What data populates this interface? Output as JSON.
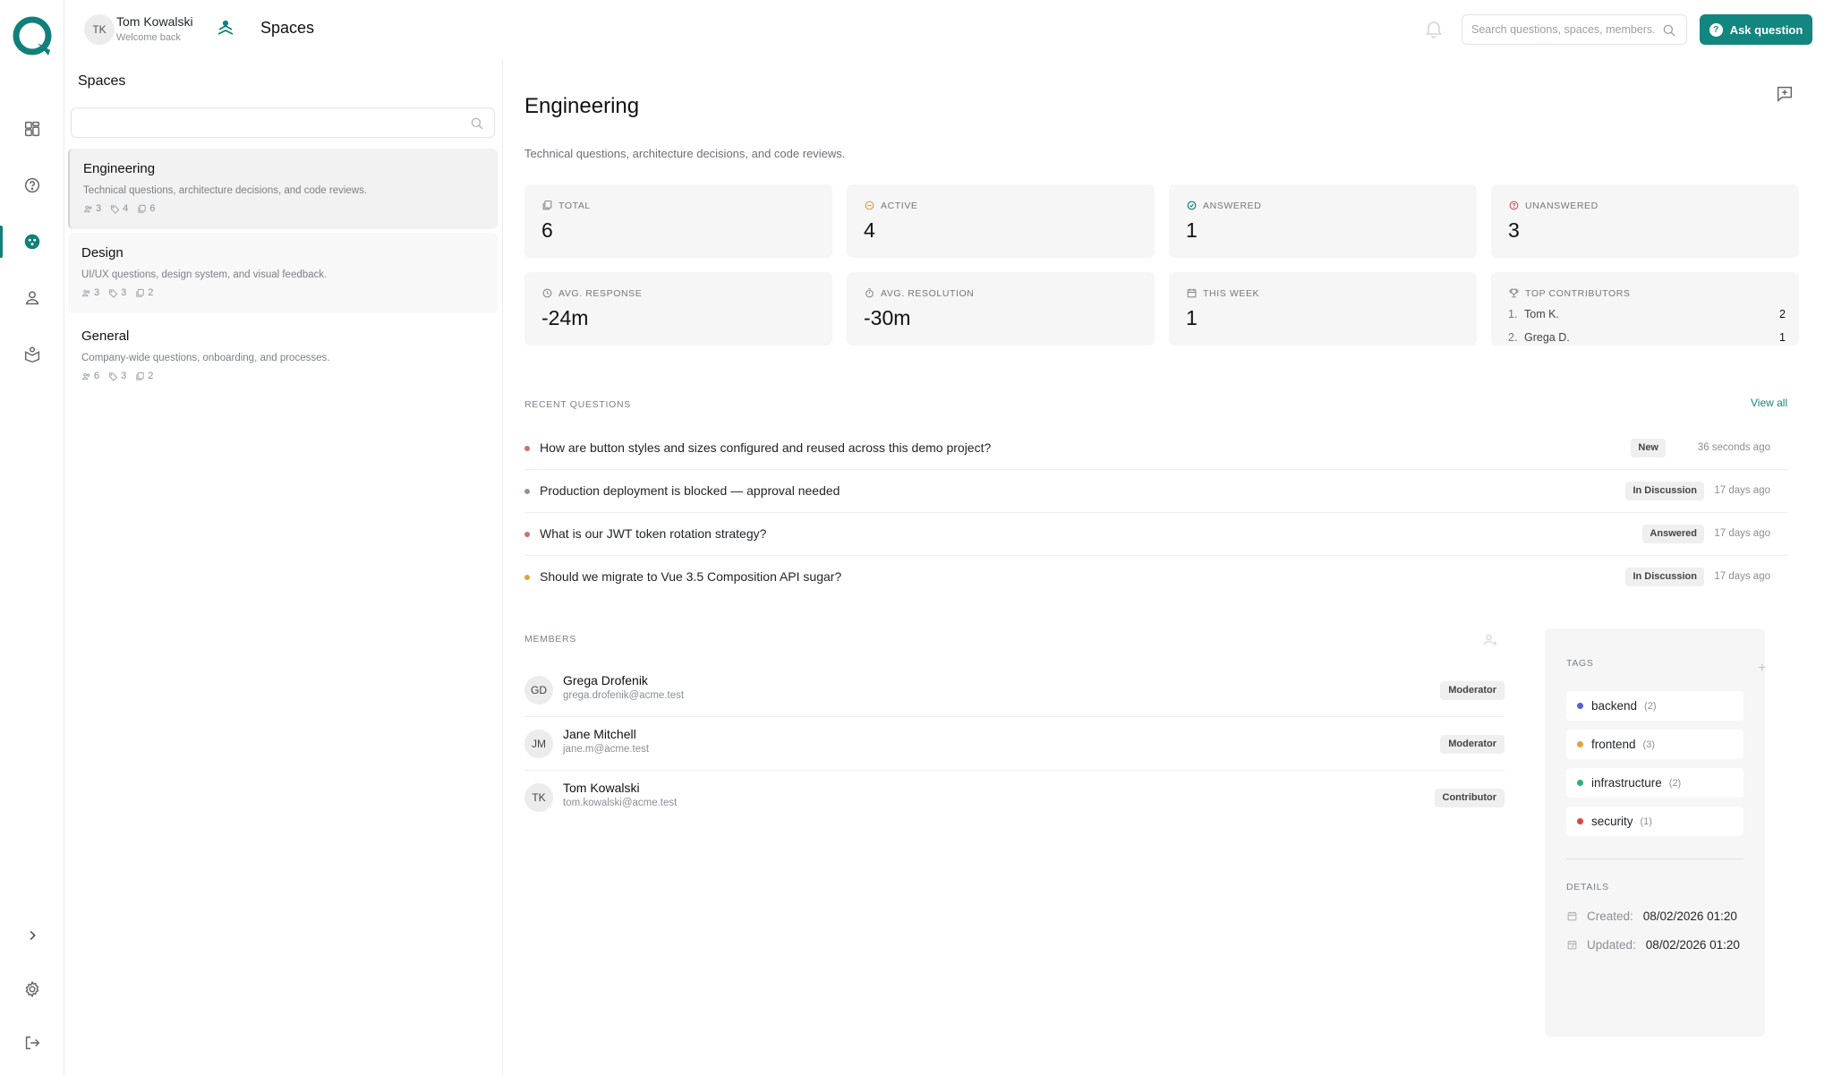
{
  "header": {
    "avatar_initials": "TK",
    "user_name": "Tom Kowalski",
    "user_subtitle": "Welcome back",
    "page_title": "Spaces",
    "search_placeholder": "Search questions, spaces, members...",
    "ask_button": "Ask question",
    "brand_color": "#12867f"
  },
  "spaces_panel": {
    "title": "Spaces",
    "search_placeholder": "",
    "items": [
      {
        "name": "Engineering",
        "description": "Technical questions, architecture decisions, and code reviews.",
        "members": "3",
        "tags": "4",
        "questions": "6"
      },
      {
        "name": "Design",
        "description": "UI/UX questions, design system, and visual feedback.",
        "members": "3",
        "tags": "3",
        "questions": "2"
      },
      {
        "name": "General",
        "description": "Company-wide questions, onboarding, and processes.",
        "members": "6",
        "tags": "3",
        "questions": "2"
      }
    ]
  },
  "space": {
    "title": "Engineering",
    "description": "Technical questions, architecture decisions, and code reviews."
  },
  "stats": {
    "total": {
      "label": "TOTAL",
      "value": "6"
    },
    "active": {
      "label": "ACTIVE",
      "value": "4"
    },
    "answered": {
      "label": "ANSWERED",
      "value": "1"
    },
    "unanswered": {
      "label": "UNANSWERED",
      "value": "3"
    },
    "avg_response": {
      "label": "AVG. RESPONSE",
      "value": "-24m"
    },
    "avg_resolution": {
      "label": "AVG. RESOLUTION",
      "value": "-30m"
    },
    "this_week": {
      "label": "THIS WEEK",
      "value": "1"
    },
    "top_contributors": {
      "label": "TOP CONTRIBUTORS",
      "items": [
        {
          "rank": "1.",
          "name": "Tom K.",
          "count": "2"
        },
        {
          "rank": "2.",
          "name": "Grega D.",
          "count": "1"
        }
      ]
    }
  },
  "recent_questions": {
    "label": "RECENT QUESTIONS",
    "view_all": "View all",
    "items": [
      {
        "title": "How are button styles and sizes configured and reused across this demo project?",
        "status": "New",
        "time": "36 seconds ago",
        "dot_color": "#d0706b"
      },
      {
        "title": "Production deployment is blocked — approval needed",
        "status": "In Discussion",
        "time": "17 days ago",
        "dot_color": "#8a949e"
      },
      {
        "title": "What is our JWT token rotation strategy?",
        "status": "Answered",
        "time": "17 days ago",
        "dot_color": "#d0706b"
      },
      {
        "title": "Should we migrate to Vue 3.5 Composition API sugar?",
        "status": "In Discussion",
        "time": "17 days ago",
        "dot_color": "#d9a640"
      }
    ]
  },
  "members": {
    "label": "MEMBERS",
    "items": [
      {
        "initials": "GD",
        "name": "Grega Drofenik",
        "email": "grega.drofenik@acme.test",
        "role": "Moderator"
      },
      {
        "initials": "JM",
        "name": "Jane Mitchell",
        "email": "jane.m@acme.test",
        "role": "Moderator"
      },
      {
        "initials": "TK",
        "name": "Tom Kowalski",
        "email": "tom.kowalski@acme.test",
        "role": "Contributor"
      }
    ]
  },
  "tags": {
    "label": "TAGS",
    "items": [
      {
        "name": "backend",
        "count": "(2)",
        "color": "#5b5bd6"
      },
      {
        "name": "frontend",
        "count": "(3)",
        "color": "#e6a23c"
      },
      {
        "name": "infrastructure",
        "count": "(2)",
        "color": "#2fb36f"
      },
      {
        "name": "security",
        "count": "(1)",
        "color": "#e0463a"
      }
    ]
  },
  "details": {
    "label": "DETAILS",
    "created_label": "Created:",
    "created_value": "08/02/2026 01:20",
    "updated_label": "Updated:",
    "updated_value": "08/02/2026 01:20"
  }
}
